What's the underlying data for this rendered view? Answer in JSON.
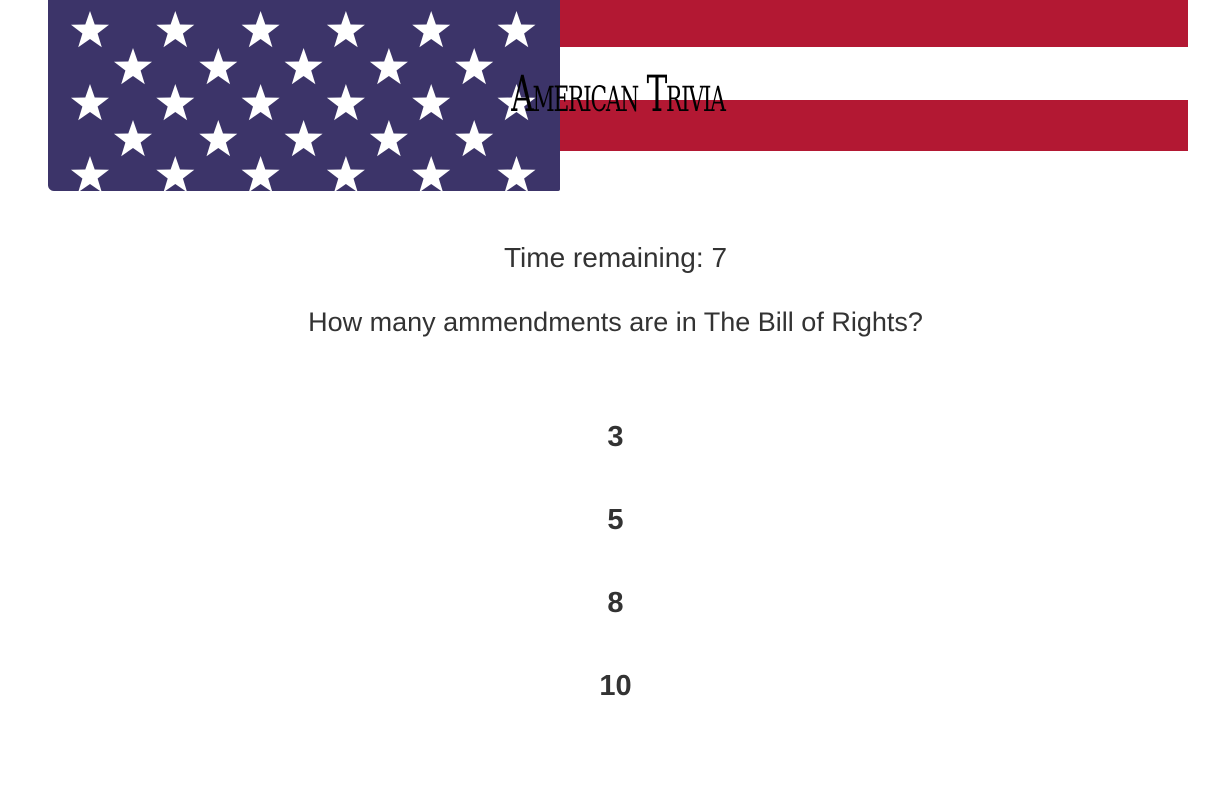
{
  "header": {
    "title": "American Trivia",
    "flag": {
      "red": "#B31833",
      "white": "#FFFFFF",
      "blue": "#3C3469",
      "star_color": "#FFFFFF"
    }
  },
  "timer": {
    "label": "Time remaining: 7",
    "seconds": 7
  },
  "question": {
    "text": "How many ammendments are in The Bill of Rights?",
    "answers": [
      {
        "label": "3"
      },
      {
        "label": "5"
      },
      {
        "label": "8"
      },
      {
        "label": "10"
      }
    ]
  }
}
